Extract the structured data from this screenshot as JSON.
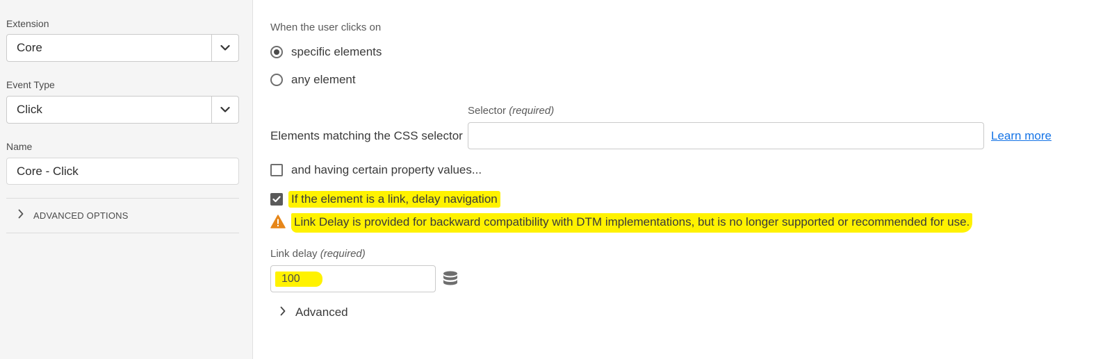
{
  "sidebar": {
    "extension": {
      "label": "Extension",
      "value": "Core"
    },
    "event_type": {
      "label": "Event Type",
      "value": "Click"
    },
    "name": {
      "label": "Name",
      "value": "Core - Click"
    },
    "advanced_options": {
      "label": "ADVANCED OPTIONS"
    }
  },
  "main": {
    "when_label": "When the user clicks on",
    "radios": [
      {
        "label": "specific elements",
        "selected": true
      },
      {
        "label": "any element",
        "selected": false
      }
    ],
    "selector": {
      "row_label": "Elements matching the CSS selector",
      "field_label": "Selector",
      "field_label_required": "(required)",
      "value": "",
      "learn_more": "Learn more"
    },
    "property_values": {
      "label": "and having certain property values...",
      "checked": false
    },
    "delay_navigation": {
      "label": "If the element is a link, delay navigation",
      "checked": true
    },
    "warning": {
      "icon": "warning-icon",
      "text": "Link Delay is provided for backward compatibility with DTM implementations, but is no longer supported or recommended for use."
    },
    "link_delay": {
      "label": "Link delay",
      "label_required": "(required)",
      "value": "100",
      "icon": "database-icon"
    },
    "advanced": {
      "label": "Advanced"
    }
  },
  "colors": {
    "highlight": "#fff200",
    "link": "#1473e6",
    "warning": "#e68619"
  }
}
